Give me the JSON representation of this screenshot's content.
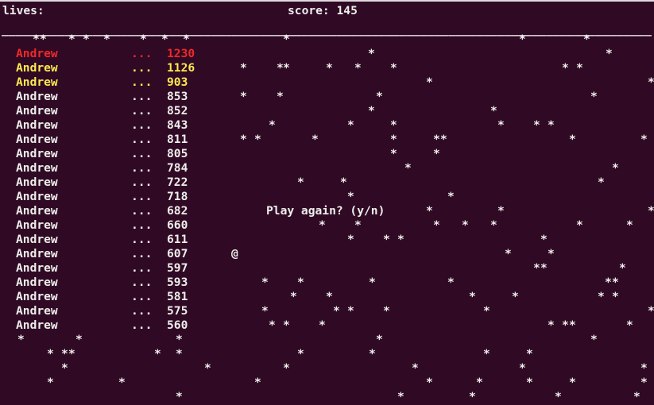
{
  "status": {
    "lives_label": "lives:",
    "score_label": "score: 145"
  },
  "divider_text": "__________________________________________________________________________________________________",
  "leaderboard": [
    {
      "name": "Andrew",
      "dots": "...",
      "score": "1230",
      "tier": "red"
    },
    {
      "name": "Andrew",
      "dots": "...",
      "score": "1126",
      "tier": "yellow"
    },
    {
      "name": "Andrew",
      "dots": "...",
      "score": "903",
      "tier": "yellow"
    },
    {
      "name": "Andrew",
      "dots": "...",
      "score": "853",
      "tier": ""
    },
    {
      "name": "Andrew",
      "dots": "...",
      "score": "852",
      "tier": ""
    },
    {
      "name": "Andrew",
      "dots": "...",
      "score": "843",
      "tier": ""
    },
    {
      "name": "Andrew",
      "dots": "...",
      "score": "811",
      "tier": ""
    },
    {
      "name": "Andrew",
      "dots": "...",
      "score": "805",
      "tier": ""
    },
    {
      "name": "Andrew",
      "dots": "...",
      "score": "784",
      "tier": ""
    },
    {
      "name": "Andrew",
      "dots": "...",
      "score": "722",
      "tier": ""
    },
    {
      "name": "Andrew",
      "dots": "...",
      "score": "718",
      "tier": ""
    },
    {
      "name": "Andrew",
      "dots": "...",
      "score": "682",
      "tier": ""
    },
    {
      "name": "Andrew",
      "dots": "...",
      "score": "660",
      "tier": ""
    },
    {
      "name": "Andrew",
      "dots": "...",
      "score": "611",
      "tier": ""
    },
    {
      "name": "Andrew",
      "dots": "...",
      "score": "607",
      "tier": ""
    },
    {
      "name": "Andrew",
      "dots": "...",
      "score": "597",
      "tier": ""
    },
    {
      "name": "Andrew",
      "dots": "...",
      "score": "593",
      "tier": ""
    },
    {
      "name": "Andrew",
      "dots": "...",
      "score": "581",
      "tier": ""
    },
    {
      "name": "Andrew",
      "dots": "...",
      "score": "575",
      "tier": ""
    },
    {
      "name": "Andrew",
      "dots": "...",
      "score": "560",
      "tier": ""
    }
  ],
  "prompt": "Play again? (y/n)",
  "player_glyph": "@",
  "star_glyph": "*",
  "colors": {
    "background": "#300a24",
    "text": "#eeeeec",
    "first_place": "#ef2929",
    "podium": "#fce94f"
  }
}
